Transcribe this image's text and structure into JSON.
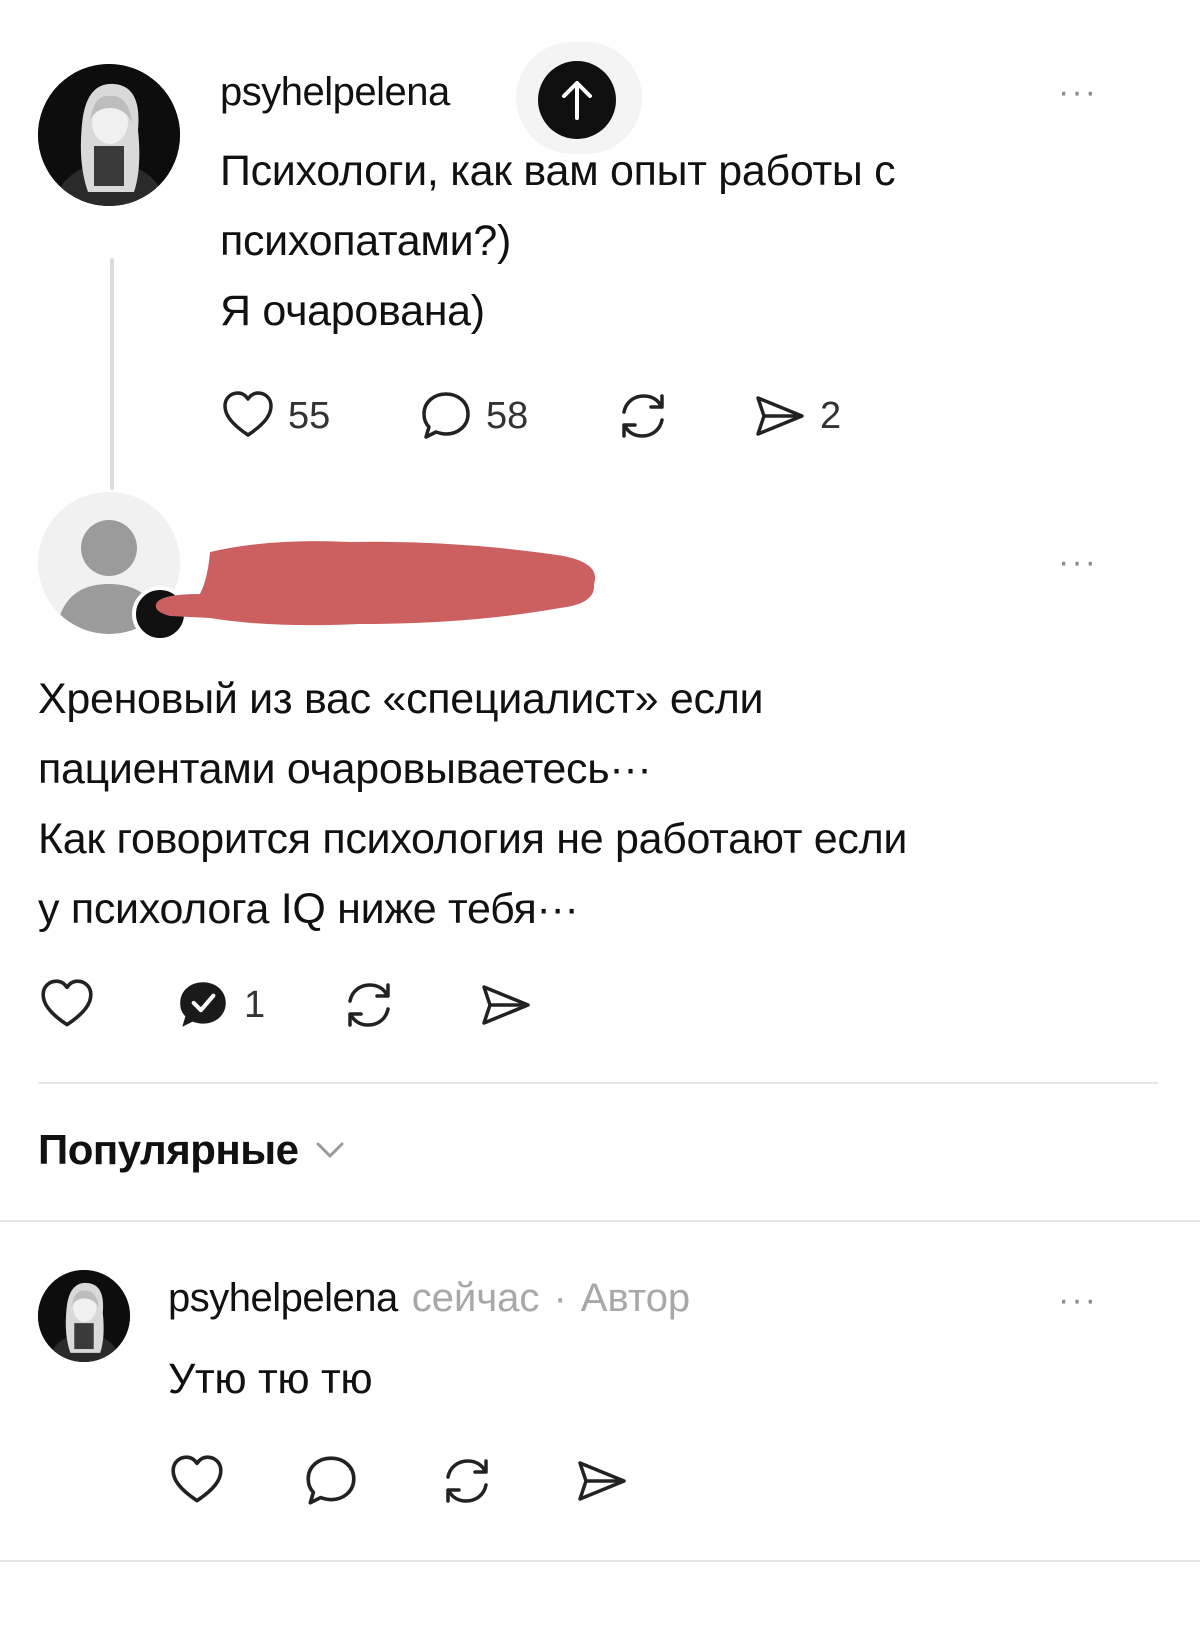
{
  "post": {
    "username": "psyhelpelena",
    "lines": [
      "Психологи, как вам опыт работы с",
      "психопатами?)",
      "Я очарована)"
    ],
    "likes": "55",
    "comments": "58",
    "shares": "2",
    "more_label": "···",
    "follow_icon": "arrow-up-icon"
  },
  "reply": {
    "username_redacted": true,
    "lines": [
      "Хреновый из вас «специалист» если",
      "пациентами очаровываетесь···",
      "Как говорится психология не работают если",
      "у психолога IQ ниже тебя···"
    ],
    "comments": "1",
    "more_label": "···"
  },
  "sort": {
    "label": "Популярные"
  },
  "comment": {
    "username": "psyhelpelena",
    "time": "сейчас",
    "separator": "·",
    "role": "Автор",
    "text": "Утю тю тю",
    "more_label": "···"
  },
  "colors": {
    "redaction": "#cc6060",
    "divider": "#e6e6e6",
    "muted": "#a8a8a8"
  }
}
